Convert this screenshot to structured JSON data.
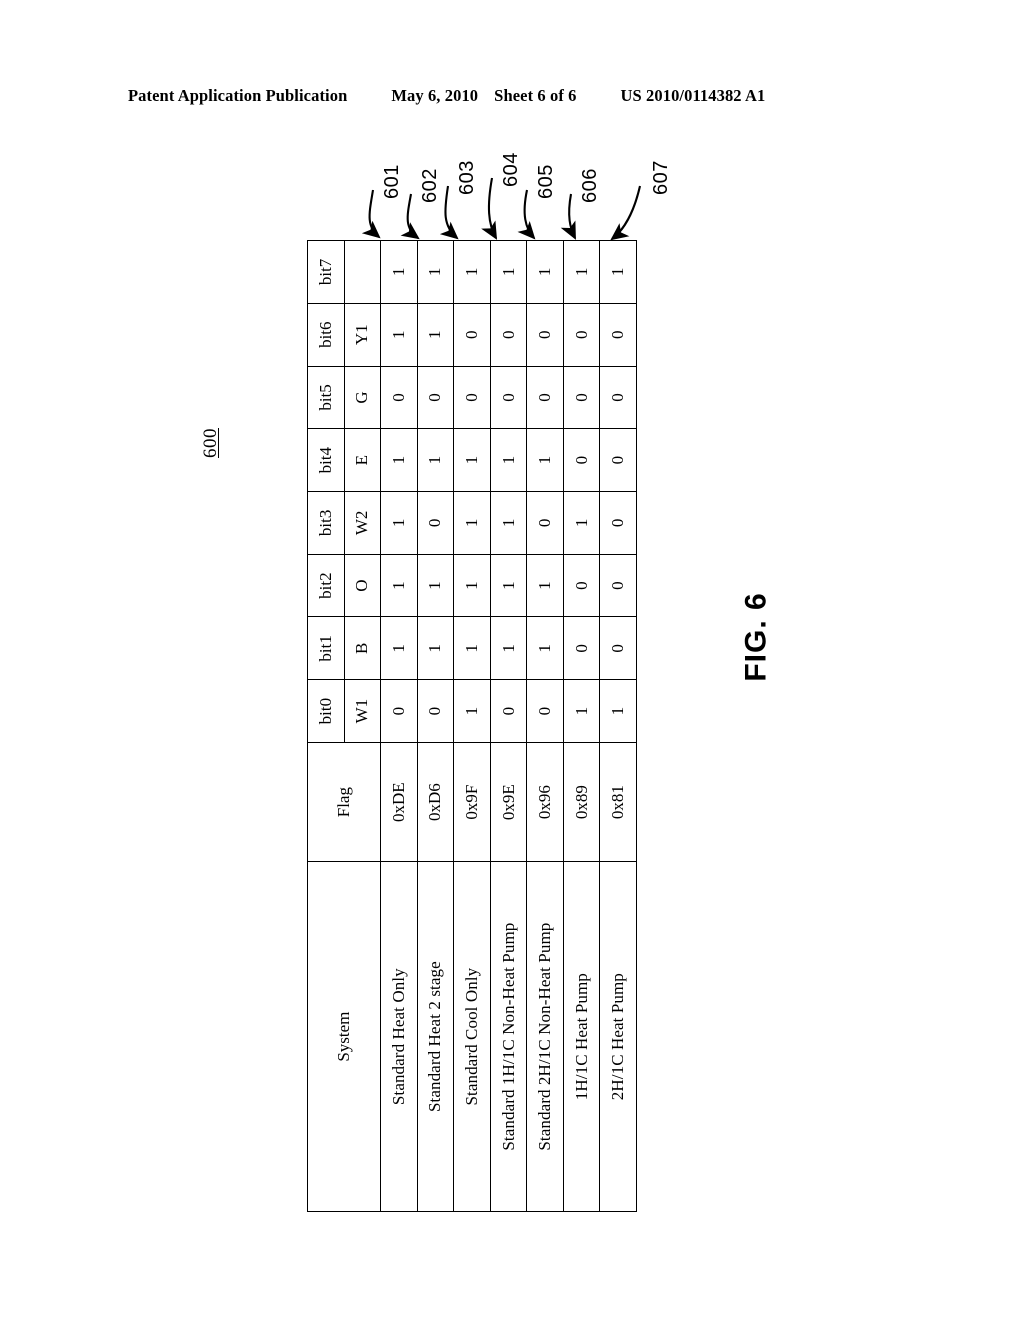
{
  "header": {
    "publication": "Patent Application Publication",
    "date": "May 6, 2010",
    "sheet": "Sheet 6 of 6",
    "patent_number": "US 2010/0114382 A1"
  },
  "figure": {
    "figure_label": "FIG. 6",
    "table_ref": "600",
    "row_refs": [
      "601",
      "602",
      "603",
      "604",
      "605",
      "606",
      "607"
    ]
  },
  "table": {
    "header_labels": {
      "system": "System",
      "flag": "Flag",
      "bit0": "bit0",
      "bit1": "bit1",
      "bit2": "bit2",
      "bit3": "bit3",
      "bit4": "bit4",
      "bit5": "bit5",
      "bit6": "bit6",
      "bit7": "bit7"
    },
    "signal_names": {
      "bit0": "W1",
      "bit1": "B",
      "bit2": "O",
      "bit3": "W2",
      "bit4": "E",
      "bit5": "G",
      "bit6": "Y1",
      "bit7": ""
    },
    "rows": [
      {
        "ref": "601",
        "system": "Standard Heat Only",
        "flag": "0xDE",
        "bit0": "0",
        "bit1": "1",
        "bit2": "1",
        "bit3": "1",
        "bit4": "1",
        "bit5": "0",
        "bit6": "1",
        "bit7": "1"
      },
      {
        "ref": "602",
        "system": "Standard Heat 2 stage",
        "flag": "0xD6",
        "bit0": "0",
        "bit1": "1",
        "bit2": "1",
        "bit3": "0",
        "bit4": "1",
        "bit5": "0",
        "bit6": "1",
        "bit7": "1"
      },
      {
        "ref": "603",
        "system": "Standard Cool Only",
        "flag": "0x9F",
        "bit0": "1",
        "bit1": "1",
        "bit2": "1",
        "bit3": "1",
        "bit4": "1",
        "bit5": "0",
        "bit6": "0",
        "bit7": "1"
      },
      {
        "ref": "604",
        "system": "Standard 1H/1C Non-Heat Pump",
        "flag": "0x9E",
        "bit0": "0",
        "bit1": "1",
        "bit2": "1",
        "bit3": "1",
        "bit4": "1",
        "bit5": "0",
        "bit6": "0",
        "bit7": "1"
      },
      {
        "ref": "605",
        "system": "Standard 2H/1C Non-Heat Pump",
        "flag": "0x96",
        "bit0": "0",
        "bit1": "1",
        "bit2": "1",
        "bit3": "0",
        "bit4": "1",
        "bit5": "0",
        "bit6": "0",
        "bit7": "1"
      },
      {
        "ref": "606",
        "system": "1H/1C Heat Pump",
        "flag": "0x89",
        "bit0": "1",
        "bit1": "0",
        "bit2": "0",
        "bit3": "1",
        "bit4": "0",
        "bit5": "0",
        "bit6": "0",
        "bit7": "1"
      },
      {
        "ref": "607",
        "system": "2H/1C Heat Pump",
        "flag": "0x81",
        "bit0": "1",
        "bit1": "0",
        "bit2": "0",
        "bit3": "0",
        "bit4": "0",
        "bit5": "0",
        "bit6": "0",
        "bit7": "1"
      }
    ]
  }
}
